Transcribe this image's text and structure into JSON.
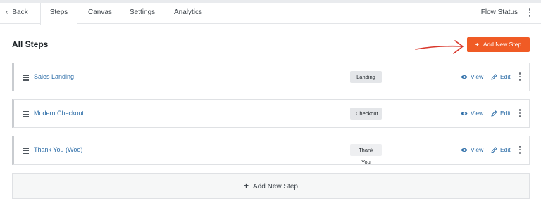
{
  "tabs": {
    "back_label": "Back",
    "steps_label": "Steps",
    "canvas_label": "Canvas",
    "settings_label": "Settings",
    "analytics_label": "Analytics",
    "flow_status_label": "Flow Status"
  },
  "page": {
    "title": "All Steps",
    "add_button_label": "Add New Step",
    "add_bottom_label": "Add New Step"
  },
  "steps": [
    {
      "name": "Sales Landing",
      "type": "Landing",
      "view_label": "View",
      "edit_label": "Edit"
    },
    {
      "name": "Modern Checkout",
      "type": "Checkout",
      "view_label": "View",
      "edit_label": "Edit"
    },
    {
      "name": "Thank You (Woo)",
      "type": "Thank You",
      "view_label": "View",
      "edit_label": "Edit"
    }
  ],
  "colors": {
    "accent": "#f05b25",
    "link": "#2e6ea8",
    "annotation_arrow": "#d9382c"
  },
  "icons": {
    "back": "chevron-left-icon",
    "menu": "vertical-dots-icon",
    "drag": "drag-handle-icon",
    "view": "eye-icon",
    "edit": "pencil-icon",
    "add": "plus-icon"
  }
}
